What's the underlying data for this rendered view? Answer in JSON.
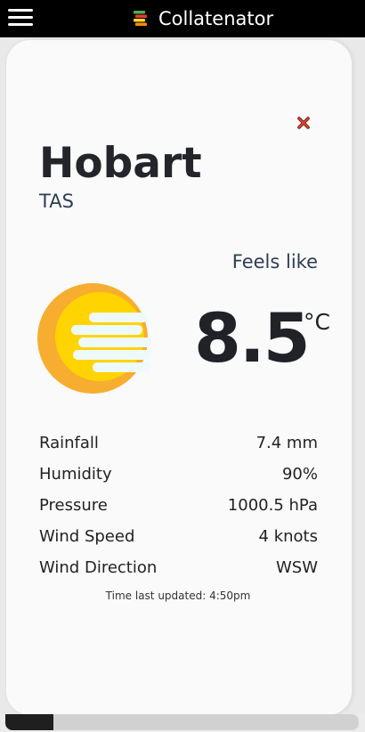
{
  "header": {
    "app_title": "Collatenator",
    "menu_icon": "hamburger-menu-icon",
    "logo_icon": "books-stack-icon"
  },
  "card": {
    "close_icon": "close-x-icon",
    "city": "Hobart",
    "state": "TAS",
    "feels_like_label": "Feels like",
    "temperature": "8.5",
    "temperature_unit": "°C",
    "weather_icon": "sun-behind-fog-icon",
    "stats": [
      {
        "label": "Rainfall",
        "value": "7.4 mm"
      },
      {
        "label": "Humidity",
        "value": "90%"
      },
      {
        "label": "Pressure",
        "value": "1000.5 hPa"
      },
      {
        "label": "Wind Speed",
        "value": "4 knots"
      },
      {
        "label": "Wind Direction",
        "value": "WSW"
      }
    ],
    "last_updated": "Time last updated: 4:50pm"
  },
  "colors": {
    "topbar": "#000000",
    "card_background": "#fafafa",
    "sun_outer": "#f7ad2f",
    "sun_inner": "#ffd400",
    "fog": "#eef9fb",
    "close_icon": "#e0412f"
  }
}
